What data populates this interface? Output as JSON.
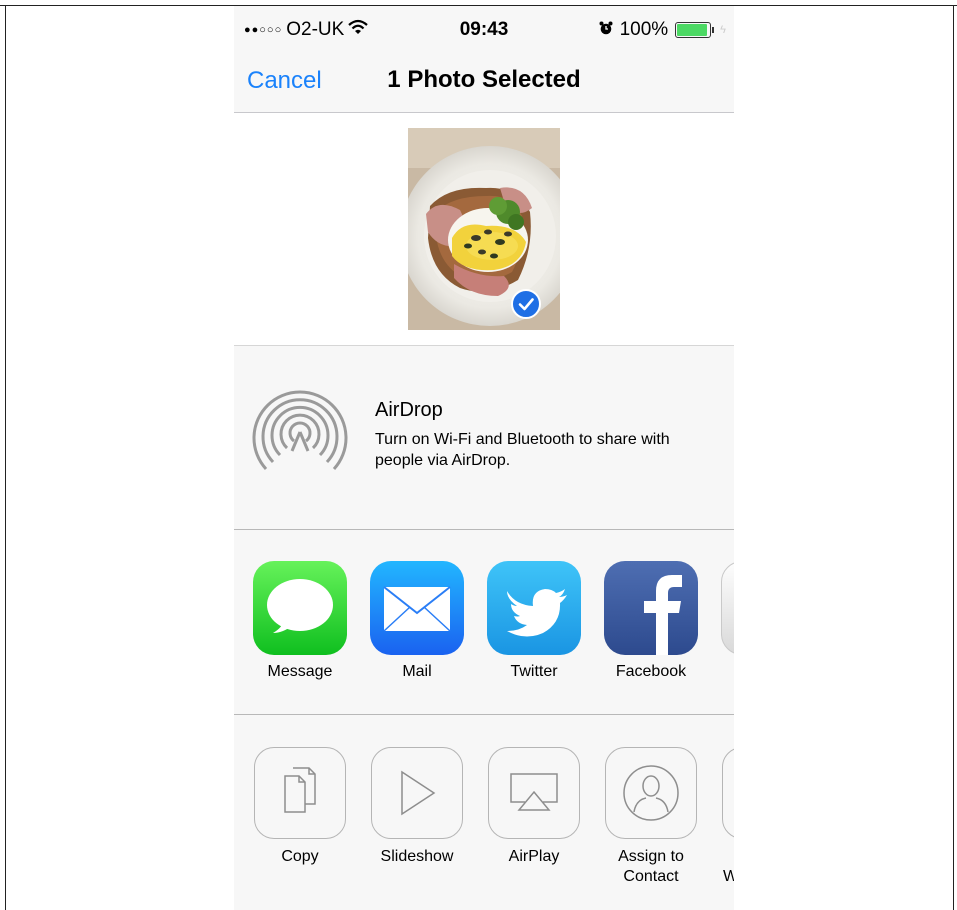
{
  "status_bar": {
    "signal_dots": "●●○○○",
    "carrier": "O2-UK",
    "wifi_icon": "wifi-icon",
    "time": "09:43",
    "alarm_icon": "alarm-icon",
    "battery_percent": "100%",
    "battery_level": 1.0
  },
  "nav": {
    "cancel_label": "Cancel",
    "title": "1 Photo Selected"
  },
  "photo": {
    "selected": true
  },
  "airdrop": {
    "title": "AirDrop",
    "description": "Turn on Wi-Fi and Bluetooth to share with people via AirDrop."
  },
  "share_apps": [
    {
      "label": "Message",
      "icon": "message-icon"
    },
    {
      "label": "Mail",
      "icon": "mail-icon"
    },
    {
      "label": "Twitter",
      "icon": "twitter-icon"
    },
    {
      "label": "Facebook",
      "icon": "facebook-icon"
    }
  ],
  "actions": [
    {
      "label": "Copy",
      "icon": "copy-icon"
    },
    {
      "label": "Slideshow",
      "icon": "slideshow-icon"
    },
    {
      "label": "AirPlay",
      "icon": "airplay-icon"
    },
    {
      "label": "Assign to Contact",
      "icon": "contact-icon"
    },
    {
      "label": "W",
      "icon": "partial-action-icon"
    }
  ],
  "colors": {
    "accent": "#1a82fb",
    "battery": "#4cd964",
    "background": "#f7f7f7"
  }
}
